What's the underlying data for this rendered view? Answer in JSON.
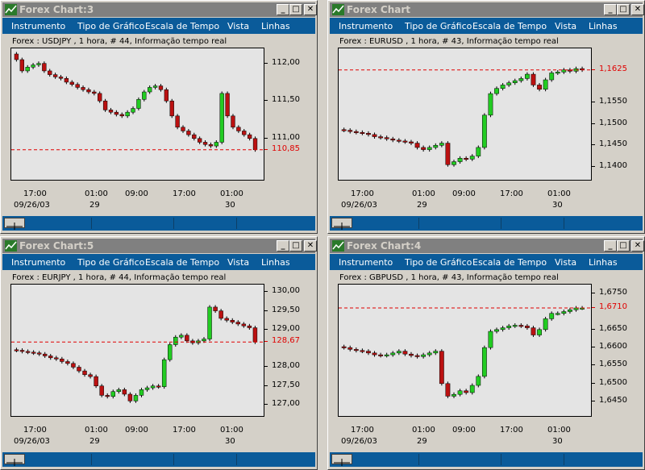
{
  "menu": [
    "Instrumento",
    "Tipo de Gráfico",
    "Escala de Tempo",
    "Vista",
    "Linhas"
  ],
  "colors": {
    "up": "#22cc22",
    "down": "#bb1111",
    "last": "#e00000",
    "menubar": "#0a5b9a"
  },
  "windows": [
    {
      "title": "Forex Chart:3",
      "info": "Forex : USDJPY , 1 hora, # 44, Informação tempo real",
      "yticks": [
        "112,00",
        "111,50",
        "111,00"
      ],
      "last_label": "110,85",
      "ymin": 110.45,
      "ymax": 112.2,
      "yvals": [
        112.0,
        111.5,
        111.0
      ],
      "last": 110.85,
      "xlabels": [
        {
          "t": "17:00",
          "d": "09/26/03"
        },
        {
          "t": "01:00",
          "d": "29"
        },
        {
          "t": "09:00",
          "d": ""
        },
        {
          "t": "17:00",
          "d": ""
        },
        {
          "t": "01:00",
          "d": "30"
        }
      ],
      "chart_data": {
        "type": "candlestick",
        "closes": [
          112.05,
          111.9,
          111.95,
          111.98,
          112.0,
          111.9,
          111.85,
          111.82,
          111.8,
          111.75,
          111.72,
          111.68,
          111.65,
          111.62,
          111.6,
          111.5,
          111.38,
          111.35,
          111.32,
          111.3,
          111.35,
          111.4,
          111.52,
          111.62,
          111.68,
          111.7,
          111.65,
          111.5,
          111.3,
          111.15,
          111.1,
          111.05,
          111.0,
          110.95,
          110.92,
          110.9,
          110.95,
          111.6,
          111.3,
          111.15,
          111.1,
          111.05,
          111.0,
          110.85
        ]
      }
    },
    {
      "title": "Forex Chart",
      "info": "Forex : EURUSD , 1 hora, # 43, Informação tempo real",
      "yticks": [
        "1,1550",
        "1,1500",
        "1,1450",
        "1,1400"
      ],
      "last_label": "1,1625",
      "ymin": 1.137,
      "ymax": 1.1675,
      "yvals": [
        1.155,
        1.15,
        1.145,
        1.14
      ],
      "last": 1.1625,
      "xlabels": [
        {
          "t": "17:00",
          "d": "09/26/03"
        },
        {
          "t": "01:00",
          "d": "29"
        },
        {
          "t": "09:00",
          "d": ""
        },
        {
          "t": "17:00",
          "d": ""
        },
        {
          "t": "01:00",
          "d": "30"
        }
      ],
      "chart_data": {
        "type": "candlestick",
        "closes": [
          1.1485,
          1.1482,
          1.148,
          1.1478,
          1.1475,
          1.147,
          1.1468,
          1.1465,
          1.1462,
          1.146,
          1.1458,
          1.1455,
          1.1445,
          1.144,
          1.1445,
          1.145,
          1.1455,
          1.1405,
          1.1412,
          1.142,
          1.1418,
          1.1425,
          1.1445,
          1.152,
          1.157,
          1.1582,
          1.159,
          1.1595,
          1.16,
          1.1605,
          1.1615,
          1.159,
          1.158,
          1.1602,
          1.1618,
          1.162,
          1.1625,
          1.1622,
          1.1628,
          1.1625
        ]
      }
    },
    {
      "title": "Forex Chart:5",
      "info": "Forex : EURJPY , 1 hora, # 44, Informação tempo real",
      "yticks": [
        "130,00",
        "129,50",
        "129,00",
        "128,00",
        "127,50",
        "127,00"
      ],
      "last_label": "128,67",
      "ymin": 126.7,
      "ymax": 130.2,
      "yvals": [
        130.0,
        129.5,
        129.0,
        128.0,
        127.5,
        127.0
      ],
      "last": 128.67,
      "xlabels": [
        {
          "t": "17:00",
          "d": "09/26/03"
        },
        {
          "t": "01:00",
          "d": "29"
        },
        {
          "t": "09:00",
          "d": ""
        },
        {
          "t": "17:00",
          "d": ""
        },
        {
          "t": "01:00",
          "d": "30"
        }
      ],
      "chart_data": {
        "type": "candlestick",
        "closes": [
          128.45,
          128.42,
          128.4,
          128.38,
          128.35,
          128.3,
          128.25,
          128.22,
          128.15,
          128.1,
          128.0,
          127.9,
          127.8,
          127.75,
          127.5,
          127.25,
          127.22,
          127.35,
          127.4,
          127.28,
          127.1,
          127.25,
          127.4,
          127.45,
          127.5,
          127.48,
          128.2,
          128.6,
          128.8,
          128.85,
          128.7,
          128.65,
          128.7,
          128.75,
          129.6,
          129.5,
          129.3,
          129.25,
          129.2,
          129.15,
          129.1,
          129.05,
          128.67
        ]
      }
    },
    {
      "title": "Forex Chart:4",
      "info": "Forex : GBPUSD , 1 hora, # 43, Informação tempo real",
      "yticks": [
        "1,6750",
        "1,6650",
        "1,6600",
        "1,6550",
        "1,6500",
        "1,6450"
      ],
      "last_label": "1,6710",
      "ymin": 1.641,
      "ymax": 1.6775,
      "yvals": [
        1.675,
        1.665,
        1.66,
        1.655,
        1.65,
        1.645
      ],
      "last": 1.671,
      "xlabels": [
        {
          "t": "17:00",
          "d": "09/26/03"
        },
        {
          "t": "01:00",
          "d": "29"
        },
        {
          "t": "09:00",
          "d": ""
        },
        {
          "t": "17:00",
          "d": ""
        },
        {
          "t": "01:00",
          "d": "30"
        }
      ],
      "chart_data": {
        "type": "candlestick",
        "closes": [
          1.66,
          1.6595,
          1.6592,
          1.659,
          1.6585,
          1.658,
          1.6578,
          1.658,
          1.6585,
          1.659,
          1.6582,
          1.6578,
          1.6575,
          1.658,
          1.6585,
          1.659,
          1.65,
          1.6465,
          1.647,
          1.648,
          1.6475,
          1.6495,
          1.652,
          1.66,
          1.6645,
          1.665,
          1.6655,
          1.666,
          1.6662,
          1.666,
          1.6655,
          1.6635,
          1.665,
          1.668,
          1.6695,
          1.6695,
          1.67,
          1.6705,
          1.671,
          1.671
        ]
      }
    }
  ]
}
